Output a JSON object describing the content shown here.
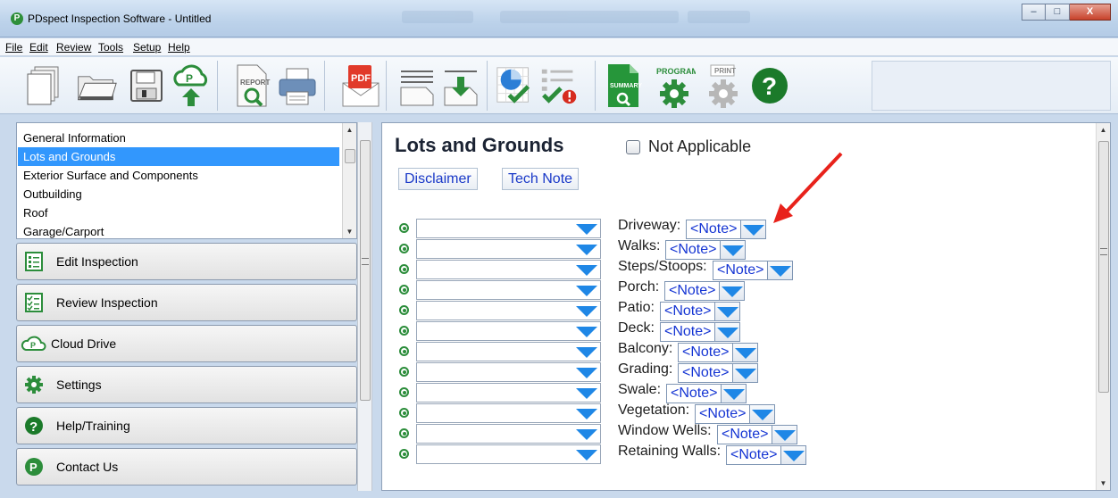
{
  "window": {
    "title": "PDspect Inspection Software - Untitled",
    "logo_glyph": "P",
    "minimize": "–",
    "maximize": "□",
    "close": "X"
  },
  "menu": [
    "File",
    "Edit",
    "Review",
    "Tools",
    "Setup",
    "Help"
  ],
  "toolbar": {
    "icons": [
      "new-document-icon",
      "open-folder-icon",
      "save-disk-icon",
      "cloud-upload-icon",
      "report-preview-icon",
      "print-icon",
      "pdf-email-icon",
      "document-lines-icon",
      "import-icon",
      "chart-check-icon",
      "checklist-error-icon",
      "summary-icon",
      "program-settings-icon",
      "print-settings-icon",
      "help-icon"
    ],
    "report_text": "REPORT",
    "pdf_text": "PDF",
    "summary_text": "SUMMARY",
    "program_text": "PROGRAM",
    "print_text": "PRINT"
  },
  "nav": {
    "items": [
      {
        "label": "General Information",
        "selected": false
      },
      {
        "label": "Lots and Grounds",
        "selected": true
      },
      {
        "label": "Exterior Surface and Components",
        "selected": false
      },
      {
        "label": "Outbuilding",
        "selected": false
      },
      {
        "label": "Roof",
        "selected": false
      },
      {
        "label": "Garage/Carport",
        "selected": false
      }
    ]
  },
  "panel_buttons": [
    {
      "label": "Edit Inspection",
      "icon": "edit-list-icon"
    },
    {
      "label": "Review Inspection",
      "icon": "review-checklist-icon"
    },
    {
      "label": "Cloud Drive",
      "icon": "cloud-icon"
    },
    {
      "label": "Settings",
      "icon": "gear-icon"
    },
    {
      "label": "Help/Training",
      "icon": "help-icon"
    },
    {
      "label": "Contact Us",
      "icon": "pdspect-logo-icon"
    }
  ],
  "main": {
    "title": "Lots and Grounds",
    "not_applicable_label": "Not Applicable",
    "not_applicable_checked": false,
    "disclaimer_label": "Disclaimer",
    "tech_note_label": "Tech Note",
    "note_placeholder": "<Note>",
    "rows": [
      {
        "label": "Driveway:"
      },
      {
        "label": "Walks:"
      },
      {
        "label": "Steps/Stoops:"
      },
      {
        "label": "Porch:"
      },
      {
        "label": "Patio:"
      },
      {
        "label": "Deck:"
      },
      {
        "label": "Balcony:"
      },
      {
        "label": "Grading:"
      },
      {
        "label": "Swale:"
      },
      {
        "label": "Vegetation:"
      },
      {
        "label": "Window Wells:"
      },
      {
        "label": "Retaining Walls:"
      }
    ]
  },
  "colors": {
    "selection": "#3297fd",
    "link_blue": "#1535d3",
    "dropdown_arrow": "#1f87e6",
    "bullet_green": "#2c8d3b",
    "annotation_red": "#e8221b"
  }
}
